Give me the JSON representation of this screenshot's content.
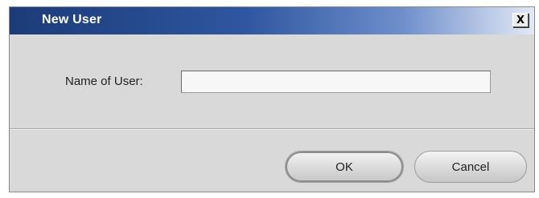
{
  "dialog": {
    "title": "New User",
    "close_label": "X"
  },
  "form": {
    "name_label": "Name of User:",
    "name_value": "",
    "name_placeholder": ""
  },
  "buttons": {
    "ok_label": "OK",
    "cancel_label": "Cancel"
  }
}
